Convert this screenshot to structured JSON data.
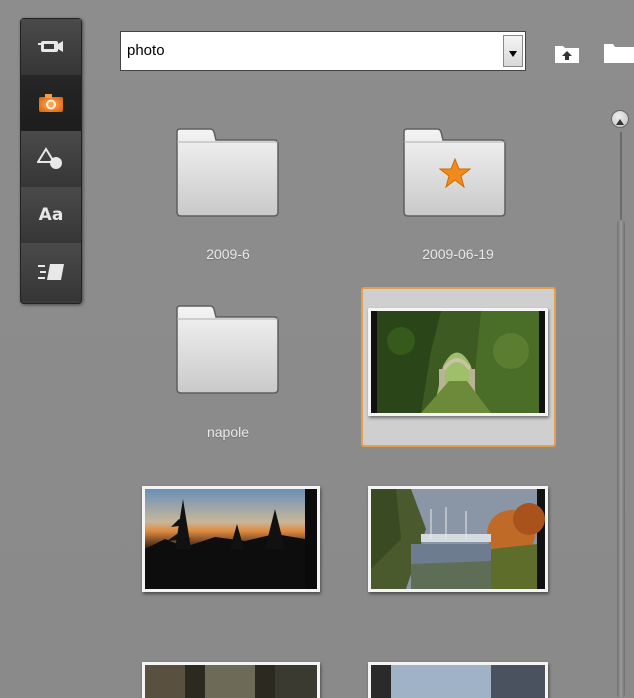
{
  "sidebar": {
    "tools": [
      {
        "name": "video-icon"
      },
      {
        "name": "camera-icon",
        "active": true
      },
      {
        "name": "shapes-icon"
      },
      {
        "name": "text-icon",
        "label": "Aa"
      },
      {
        "name": "transition-icon"
      }
    ]
  },
  "header": {
    "folder_select": {
      "value": "photo"
    }
  },
  "grid": {
    "items": [
      {
        "type": "folder",
        "label": "2009-6"
      },
      {
        "type": "folder",
        "label": "2009-06-19",
        "starred": true
      },
      {
        "type": "folder",
        "label": "napole"
      },
      {
        "type": "photo",
        "description": "garden archway",
        "selected": true
      },
      {
        "type": "photo",
        "description": "sunset trees"
      },
      {
        "type": "photo",
        "description": "harbor autumn"
      },
      {
        "type": "photo",
        "description": "partial"
      },
      {
        "type": "photo",
        "description": "partial"
      }
    ]
  },
  "colors": {
    "panel": "#8b8b8b",
    "accent": "#e0a050",
    "toolbar": "#3b3b3b"
  }
}
